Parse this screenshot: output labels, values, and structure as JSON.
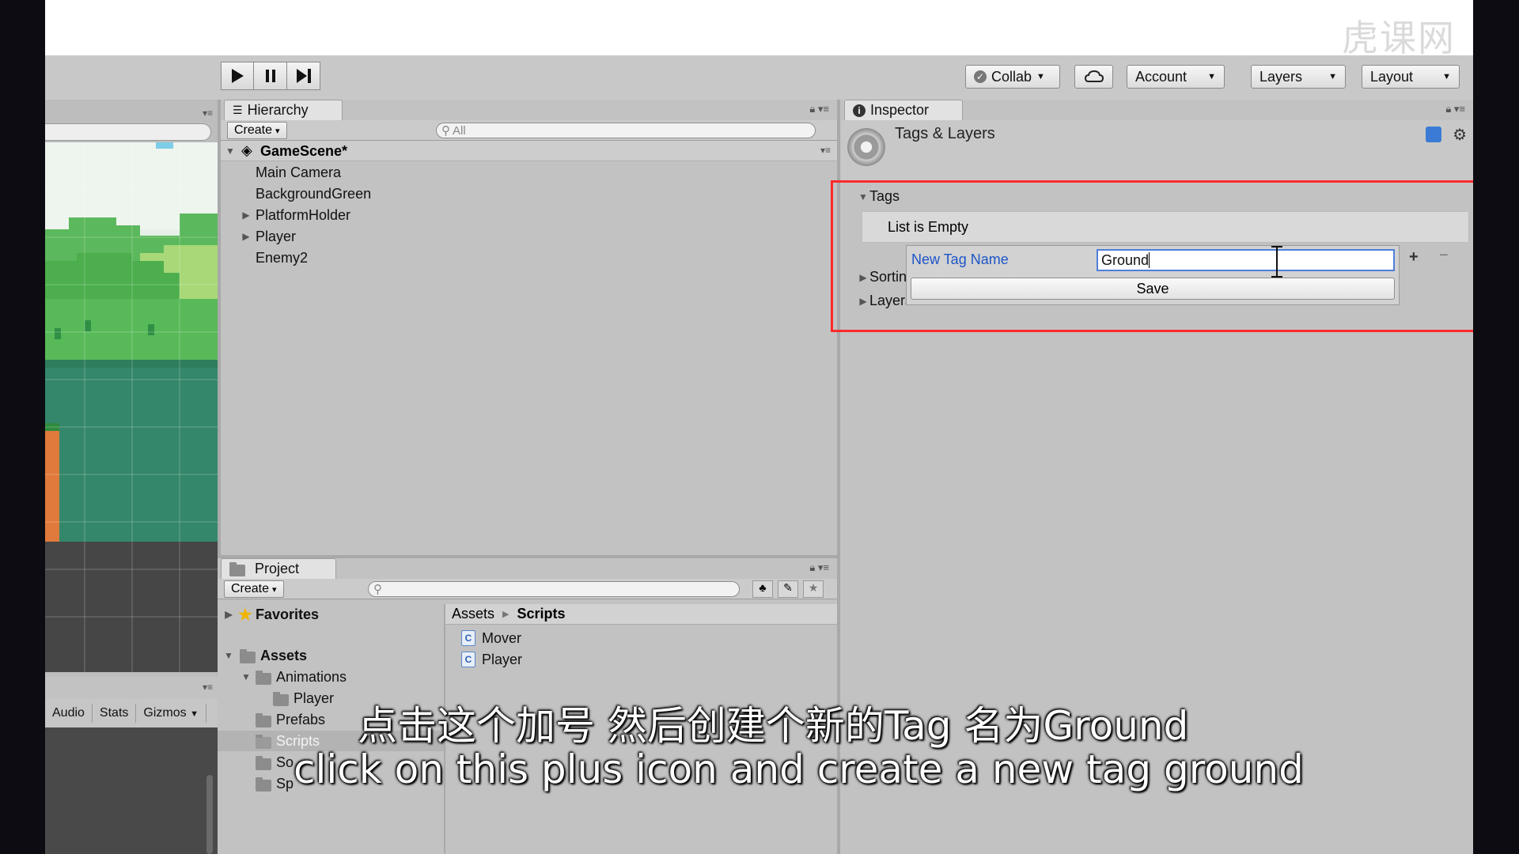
{
  "toolbar": {
    "collab_label": "Collab",
    "account_label": "Account",
    "layers_label": "Layers",
    "layout_label": "Layout"
  },
  "scene_bottom": {
    "audio": "Audio",
    "stats": "Stats",
    "gizmos": "Gizmos"
  },
  "hierarchy": {
    "tab": "Hierarchy",
    "create": "Create",
    "search_placeholder": "All",
    "scene": "GameScene*",
    "items": [
      "Main Camera",
      "BackgroundGreen",
      "PlatformHolder",
      "Player",
      "Enemy2"
    ]
  },
  "inspector": {
    "tab": "Inspector",
    "title": "Tags & Layers",
    "tags_label": "Tags",
    "list_empty": "List is Empty",
    "sorting_label": "Sortin",
    "layers_label": "Layers",
    "new_tag_label": "New Tag Name",
    "new_tag_value": "Ground",
    "save_label": "Save",
    "plus": "+",
    "minus": "−"
  },
  "project": {
    "tab": "Project",
    "create": "Create",
    "favorites": "Favorites",
    "assets": "Assets",
    "animations": "Animations",
    "player_folder": "Player",
    "prefabs": "Prefabs",
    "scripts": "Scripts",
    "so": "So",
    "sp": "Sp",
    "breadcrumb_root": "Assets",
    "breadcrumb_current": "Scripts",
    "files": [
      "Mover",
      "Player"
    ]
  },
  "subtitles": {
    "zh": "点击这个加号 然后创建个新的Tag 名为Ground",
    "en": "click on this plus icon and create a new tag ground"
  },
  "watermark": "虎课网"
}
